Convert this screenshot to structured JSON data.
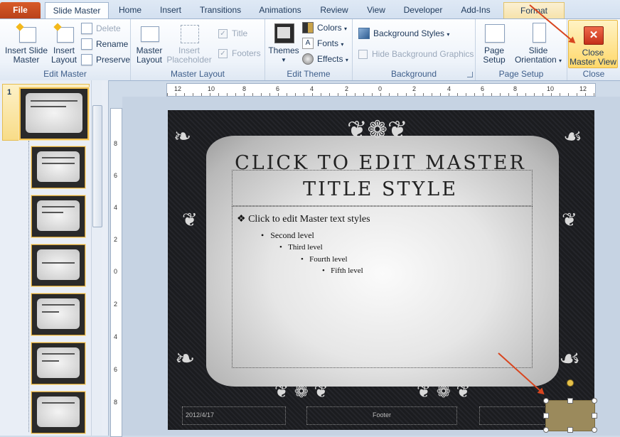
{
  "tabs": {
    "file": "File",
    "slide_master": "Slide Master",
    "home": "Home",
    "insert": "Insert",
    "transitions": "Transitions",
    "animations": "Animations",
    "review": "Review",
    "view": "View",
    "developer": "Developer",
    "addins": "Add-Ins",
    "format": "Format"
  },
  "ribbon": {
    "edit_master": {
      "label": "Edit Master",
      "insert_slide_master": [
        "Insert Slide",
        "Master"
      ],
      "insert_layout": [
        "Insert",
        "Layout"
      ],
      "delete": "Delete",
      "rename": "Rename",
      "preserve": "Preserve"
    },
    "master_layout": {
      "label": "Master Layout",
      "master_layout": [
        "Master",
        "Layout"
      ],
      "insert_placeholder": [
        "Insert",
        "Placeholder"
      ],
      "title": "Title",
      "footers": "Footers"
    },
    "edit_theme": {
      "label": "Edit Theme",
      "themes": "Themes",
      "colors": "Colors",
      "fonts": "Fonts",
      "effects": "Effects"
    },
    "background": {
      "label": "Background",
      "background_styles": "Background Styles",
      "hide_background_graphics": "Hide Background Graphics"
    },
    "page_setup": {
      "label": "Page Setup",
      "page_setup": [
        "Page",
        "Setup"
      ],
      "slide_orientation": [
        "Slide",
        "Orientation"
      ]
    },
    "close": {
      "label": "Close",
      "close_master_view": [
        "Close",
        "Master View"
      ]
    }
  },
  "thumbnails": {
    "first_number": "1",
    "count": 7
  },
  "ruler": {
    "horizontal": [
      "12",
      "10",
      "8",
      "6",
      "4",
      "2",
      "0",
      "2",
      "4",
      "6",
      "8",
      "10",
      "12"
    ],
    "vertical": [
      "8",
      "6",
      "4",
      "2",
      "0",
      "2",
      "4",
      "6",
      "8"
    ]
  },
  "slide": {
    "title_line1": "CLICK TO EDIT MASTER",
    "title_line2": "TITLE STYLE",
    "level1": "Click to edit Master text styles",
    "level2": "Second level",
    "level3": "Third level",
    "level4": "Fourth level",
    "level5": "Fifth level",
    "date": "2012/4/17",
    "footer": "Footer"
  },
  "colors": {
    "file_tab": "#c74a1f",
    "accent_arrow": "#d8451f",
    "selection": "#f2c14e",
    "shape_fill": "#9b8a5c"
  }
}
